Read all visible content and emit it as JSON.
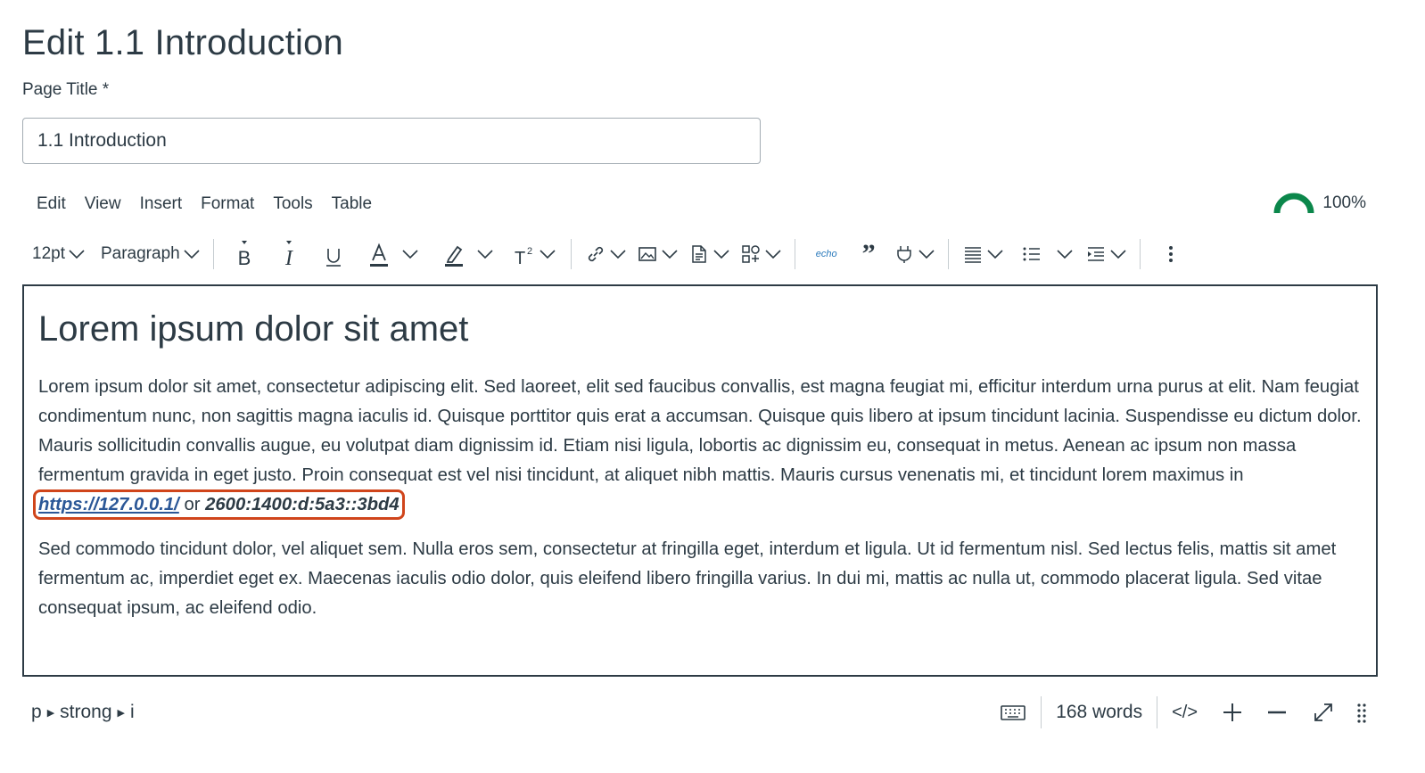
{
  "page": {
    "heading": "Edit 1.1 Introduction"
  },
  "title_field": {
    "label": "Page Title",
    "required_marker": "*",
    "value": "1.1 Introduction"
  },
  "menubar": {
    "items": [
      "Edit",
      "View",
      "Insert",
      "Format",
      "Tools",
      "Table"
    ]
  },
  "accessibility_score": {
    "text": "100%",
    "color": "#0b874b"
  },
  "toolbar": {
    "font_size": "12pt",
    "block_format": "Paragraph",
    "icons": [
      "bold-icon",
      "italic-icon",
      "underline-icon",
      "text-color-icon",
      "highlight-color-icon",
      "superscript-icon",
      "link-icon",
      "image-icon",
      "document-icon",
      "apps-icon",
      "echo-icon",
      "blockquote-icon",
      "plugin-icon",
      "align-icon",
      "bullet-list-icon",
      "indent-icon",
      "more-icon"
    ],
    "echo_label": "echo",
    "quote_glyph": "”"
  },
  "editor": {
    "heading": "Lorem ipsum dolor sit amet",
    "paragraph1_text": "Lorem ipsum dolor sit amet, consectetur adipiscing elit. Sed laoreet, elit sed faucibus convallis, est magna feugiat mi, efficitur interdum urna purus at elit. Nam feugiat condimentum nunc, non sagittis magna iaculis id. Quisque porttitor quis erat a accumsan. Quisque quis libero at ipsum tincidunt lacinia. Suspendisse eu dictum dolor. Mauris sollicitudin convallis augue, eu volutpat diam dignissim id. Etiam nisi ligula, lobortis ac dignissim eu, consequat in metus. Aenean ac ipsum non massa fermentum gravida in eget justo. Proin consequat est vel nisi tincidunt, at aliquet nibh mattis. Mauris cursus venenatis mi, et tincidunt lorem maximus in",
    "link_text": "https://127.0.0.1/",
    "connector": " or ",
    "ipv6": "2600:1400:d:5a3::3bd4",
    "paragraph2_text": "Sed commodo tincidunt dolor, vel aliquet sem. Nulla eros sem, consectetur at fringilla eget, interdum et ligula. Ut id fermentum nisl. Sed lectus felis, mattis sit amet fermentum ac, imperdiet eget ex. Maecenas iaculis odio dolor, quis eleifend libero fringilla varius. In dui mi, mattis ac nulla ut, commodo placerat ligula. Sed vitae consequat ipsum, ac eleifend odio.",
    "highlight_color": "#d0451b"
  },
  "statusbar": {
    "path": [
      "p",
      "strong",
      "i"
    ],
    "word_count": "168 words",
    "html_toggle": "</>"
  }
}
